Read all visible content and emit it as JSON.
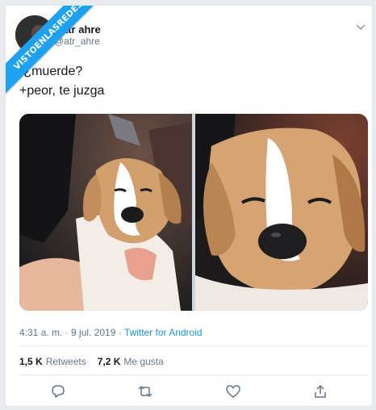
{
  "watermark": "VISTOENLASREDES",
  "tweet": {
    "display_name": "atr ahre",
    "handle": "@atr_ahre",
    "lines": [
      "-¿muerde?",
      "+peor, te juzga"
    ],
    "timestamp": "4:31 a. m. · 9 jul. 2019",
    "separator": " · ",
    "source": "Twitter for Android",
    "retweets_count": "1,5 K",
    "retweets_label": "Retweets",
    "likes_count": "7,2 K",
    "likes_label": "Me gusta"
  },
  "icons": {
    "menu": "chevron-down-icon",
    "reply": "reply-icon",
    "retweet": "retweet-icon",
    "like": "heart-icon",
    "share": "share-icon"
  },
  "colors": {
    "accent": "#1da1f2",
    "link": "#1b95e0",
    "text": "#14171a",
    "muted": "#657786"
  }
}
